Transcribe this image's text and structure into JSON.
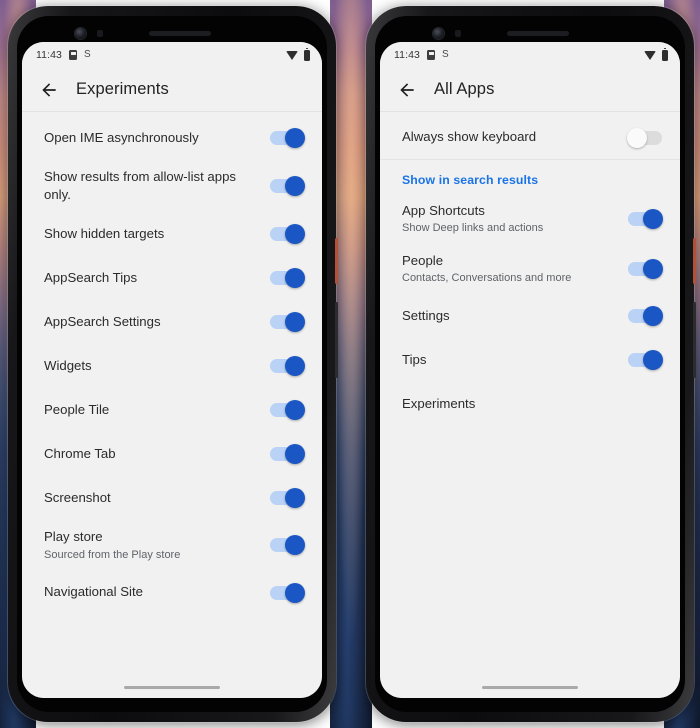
{
  "status_bar": {
    "time": "11:43",
    "icons_left": [
      "sim-card-icon",
      "s-badge-icon"
    ],
    "icons_right": [
      "wifi-icon",
      "battery-icon"
    ],
    "s_glyph": "S"
  },
  "colors": {
    "accent_blue": "#1a73e8",
    "switch_on_thumb": "#1a56c4",
    "switch_on_track": "#b9d2f5",
    "switch_off_track": "#dcdcdc",
    "screen_bg": "#f1f1f1",
    "title_text": "#232323"
  },
  "phones": [
    {
      "id": "phone-left",
      "app_bar": {
        "back_icon": "back-arrow-icon",
        "title": "Experiments"
      },
      "sections": [
        {
          "header": null,
          "rows": [
            {
              "title": "Open IME asynchronously",
              "subtitle": null,
              "switch": "on"
            },
            {
              "title": "Show results from allow-list apps only.",
              "subtitle": null,
              "switch": "on"
            },
            {
              "title": "Show hidden targets",
              "subtitle": null,
              "switch": "on"
            },
            {
              "title": "AppSearch Tips",
              "subtitle": null,
              "switch": "on"
            },
            {
              "title": "AppSearch Settings",
              "subtitle": null,
              "switch": "on"
            },
            {
              "title": "Widgets",
              "subtitle": null,
              "switch": "on"
            },
            {
              "title": "People Tile",
              "subtitle": null,
              "switch": "on"
            },
            {
              "title": "Chrome Tab",
              "subtitle": null,
              "switch": "on"
            },
            {
              "title": "Screenshot",
              "subtitle": null,
              "switch": "on"
            },
            {
              "title": "Play store",
              "subtitle": "Sourced from the Play store",
              "switch": "on"
            },
            {
              "title": "Navigational Site",
              "subtitle": null,
              "switch": "on"
            }
          ]
        }
      ]
    },
    {
      "id": "phone-right",
      "app_bar": {
        "back_icon": "back-arrow-icon",
        "title": "All Apps"
      },
      "sections": [
        {
          "header": null,
          "rows": [
            {
              "title": "Always show keyboard",
              "subtitle": null,
              "switch": "off"
            }
          ]
        },
        {
          "header": "Show in search results",
          "rows": [
            {
              "title": "App Shortcuts",
              "subtitle": "Show Deep links and actions",
              "switch": "on"
            },
            {
              "title": "People",
              "subtitle": "Contacts, Conversations and more",
              "switch": "on"
            },
            {
              "title": "Settings",
              "subtitle": null,
              "switch": "on"
            },
            {
              "title": "Tips",
              "subtitle": null,
              "switch": "on"
            },
            {
              "title": "Experiments",
              "subtitle": null,
              "switch": null
            }
          ]
        }
      ]
    }
  ]
}
